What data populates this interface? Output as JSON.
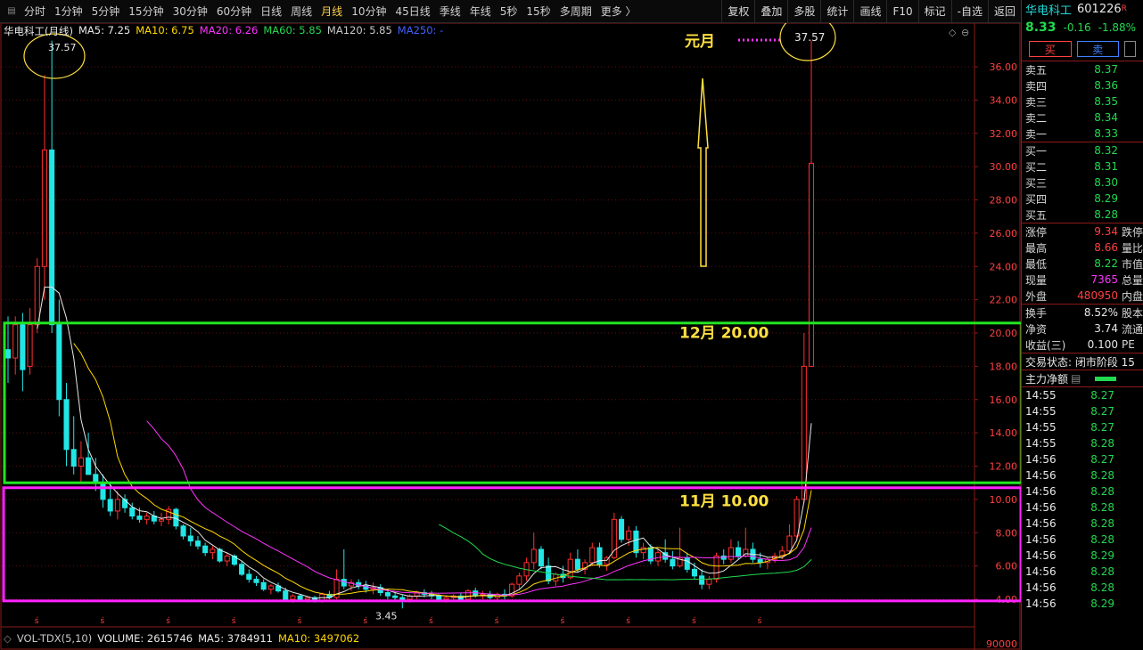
{
  "toolbar": {
    "periods": [
      "分时",
      "1分钟",
      "5分钟",
      "15分钟",
      "30分钟",
      "60分钟",
      "日线",
      "周线",
      "月线",
      "10分钟",
      "45日线",
      "季线",
      "年线",
      "5秒",
      "15秒",
      "多周期",
      "更多 〉"
    ],
    "active_period": "月线",
    "right_buttons": [
      "复权",
      "叠加",
      "多股",
      "统计",
      "画线",
      "F10",
      "标记",
      "-自选",
      "返回"
    ]
  },
  "chart_title": "华电科工(月线)",
  "ma_legend": [
    {
      "label": "MA5: 7.25",
      "color": "#e8e8e8"
    },
    {
      "label": "MA10: 6.75",
      "color": "#ffd800"
    },
    {
      "label": "MA20: 6.26",
      "color": "#ff33ff"
    },
    {
      "label": "MA60: 5.85",
      "color": "#22d94f"
    },
    {
      "label": "MA120: 5.85",
      "color": "#c8c8c8"
    },
    {
      "label": "MA250: -",
      "color": "#4060ff"
    }
  ],
  "vol_legend": [
    {
      "label": "VOL-TDX(5,10)",
      "color": "#c8c8c8"
    },
    {
      "label": "VOLUME: 2615746",
      "color": "#e8e8e8"
    },
    {
      "label": "MA5: 3784911",
      "color": "#e8e8e8"
    },
    {
      "label": "MA10: 3497062",
      "color": "#ffd800"
    }
  ],
  "annotations": {
    "high_left": "37.57",
    "high_right": "37.57",
    "low_label": "3.45",
    "yuanyue": "元月",
    "dec": "12月 20.00",
    "nov": "11月 10.00"
  },
  "axis": {
    "price_ticks": [
      "36.00",
      "34.00",
      "32.00",
      "30.00",
      "28.00",
      "26.00",
      "24.00",
      "22.00",
      "20.00",
      "18.00",
      "16.00",
      "14.00",
      "12.00",
      "10.00",
      "8.00",
      "6.00",
      "4.00"
    ],
    "vol_tick": "90000"
  },
  "chart_data": {
    "type": "candlestick",
    "title": "华电科工(月线)",
    "ylim": [
      3.45,
      37.57
    ],
    "monthly_ohlc": [
      [
        19,
        21,
        17,
        18.5
      ],
      [
        18.5,
        21,
        17.5,
        20.5
      ],
      [
        20.5,
        21.2,
        16.5,
        17.8
      ],
      [
        18,
        21.5,
        17.5,
        20.5
      ],
      [
        20.5,
        24.5,
        20,
        24
      ],
      [
        24,
        35.5,
        22,
        31
      ],
      [
        31,
        37.57,
        20,
        20.5
      ],
      [
        20.5,
        22,
        15,
        16
      ],
      [
        16,
        17,
        12,
        13
      ],
      [
        13,
        15,
        11.5,
        12
      ],
      [
        12,
        13.5,
        11,
        12.5
      ],
      [
        12.5,
        14,
        12,
        11.5
      ],
      [
        11.5,
        12.5,
        10.5,
        11
      ],
      [
        11,
        11.5,
        9.5,
        10
      ],
      [
        10,
        11,
        9,
        9.3
      ],
      [
        9.3,
        10.5,
        8.8,
        10
      ],
      [
        10,
        10.3,
        9.2,
        9.5
      ],
      [
        9.5,
        9.8,
        8.8,
        9
      ],
      [
        9,
        9.5,
        8.6,
        8.8
      ],
      [
        8.8,
        9.2,
        8.5,
        9
      ],
      [
        9,
        9.3,
        8.5,
        8.7
      ],
      [
        8.7,
        9.2,
        8.4,
        8.8
      ],
      [
        8.8,
        9.6,
        8.5,
        9.4
      ],
      [
        9.4,
        9.5,
        8.2,
        8.4
      ],
      [
        8.4,
        8.5,
        7.6,
        7.8
      ],
      [
        7.8,
        8.3,
        7.2,
        7.5
      ],
      [
        7.5,
        7.8,
        7,
        7.2
      ],
      [
        7.2,
        7.4,
        6.6,
        6.8
      ],
      [
        6.8,
        7.2,
        6.4,
        7
      ],
      [
        7,
        7.1,
        6.2,
        6.3
      ],
      [
        6.3,
        6.8,
        6,
        6.6
      ],
      [
        6.6,
        6.7,
        6,
        6.1
      ],
      [
        6.1,
        6.3,
        5.4,
        5.5
      ],
      [
        5.5,
        5.8,
        5,
        5.2
      ],
      [
        5.2,
        5.4,
        4.8,
        5
      ],
      [
        5,
        5.2,
        4.5,
        4.6
      ],
      [
        4.6,
        4.9,
        4.3,
        4.8
      ],
      [
        4.8,
        5,
        4.4,
        4.5
      ],
      [
        4.5,
        4.7,
        3.9,
        4
      ],
      [
        4,
        4.3,
        3.8,
        4.2
      ],
      [
        4.2,
        4.3,
        3.9,
        4
      ],
      [
        4,
        4.2,
        3.8,
        4.1
      ],
      [
        4.1,
        4.2,
        3.8,
        3.9
      ],
      [
        3.9,
        4.4,
        3.8,
        4.3
      ],
      [
        4.3,
        4.5,
        4,
        4.1
      ],
      [
        4.1,
        5.8,
        4,
        5.2
      ],
      [
        5.2,
        7,
        4.6,
        4.8
      ],
      [
        4.8,
        5.2,
        4.5,
        5
      ],
      [
        5,
        5.2,
        4.6,
        4.8
      ],
      [
        4.8,
        5.1,
        4.4,
        4.6
      ],
      [
        4.6,
        5,
        4.3,
        4.7
      ],
      [
        4.7,
        4.9,
        4.2,
        4.4
      ],
      [
        4.4,
        4.6,
        4,
        4.2
      ],
      [
        4.2,
        4.4,
        3.9,
        4.1
      ],
      [
        4.1,
        4.3,
        3.45,
        4
      ],
      [
        4,
        4.3,
        3.8,
        4.2
      ],
      [
        4.2,
        4.5,
        4,
        4.4
      ],
      [
        4.4,
        4.6,
        4.1,
        4.3
      ],
      [
        4.3,
        4.5,
        4,
        4.2
      ],
      [
        4.2,
        4.3,
        3.9,
        4
      ],
      [
        4,
        4.2,
        3.8,
        4.1
      ],
      [
        4.1,
        4.3,
        3.9,
        4.2
      ],
      [
        4.2,
        4.4,
        3.9,
        4
      ],
      [
        4,
        4.6,
        3.9,
        4.5
      ],
      [
        4.5,
        4.7,
        4.1,
        4.2
      ],
      [
        4.2,
        4.5,
        4,
        4.3
      ],
      [
        4.3,
        4.5,
        4,
        4.1
      ],
      [
        4.1,
        4.4,
        3.9,
        4.3
      ],
      [
        4.3,
        4.6,
        4,
        4.2
      ],
      [
        4.2,
        5,
        4.1,
        4.9
      ],
      [
        4.9,
        5.6,
        4.6,
        5.4
      ],
      [
        5.4,
        6.5,
        5.1,
        6.2
      ],
      [
        6.2,
        8,
        5.8,
        7
      ],
      [
        7,
        7.2,
        5.8,
        6
      ],
      [
        6,
        6.5,
        4.9,
        5.1
      ],
      [
        5.1,
        5.6,
        4.8,
        5.5
      ],
      [
        5.5,
        6,
        5,
        5.3
      ],
      [
        5.3,
        6.8,
        5.2,
        6.4
      ],
      [
        6.4,
        7,
        5.6,
        5.8
      ],
      [
        5.8,
        6.4,
        5.5,
        6.2
      ],
      [
        6.2,
        7.4,
        6,
        7.1
      ],
      [
        7.1,
        7.4,
        5.9,
        6.1
      ],
      [
        6.1,
        6.6,
        5.7,
        6.5
      ],
      [
        6.5,
        9.2,
        6.4,
        8.8
      ],
      [
        8.8,
        9,
        7.4,
        7.6
      ],
      [
        7.6,
        8.4,
        7.2,
        8.1
      ],
      [
        8.1,
        8.4,
        6.5,
        6.8
      ],
      [
        6.8,
        7.4,
        6.4,
        7.1
      ],
      [
        7.1,
        7.3,
        6.1,
        6.3
      ],
      [
        6.3,
        7,
        6,
        6.8
      ],
      [
        6.8,
        7.6,
        6.2,
        6.4
      ],
      [
        6.4,
        6.9,
        5.8,
        6
      ],
      [
        6,
        8.3,
        5.9,
        6.5
      ],
      [
        6.5,
        6.8,
        5.6,
        5.8
      ],
      [
        5.8,
        6.2,
        5.2,
        5.4
      ],
      [
        5.4,
        5.8,
        4.6,
        4.9
      ],
      [
        4.9,
        5.4,
        4.6,
        5.2
      ],
      [
        5.2,
        6.8,
        5,
        6.6
      ],
      [
        6.6,
        7,
        6.1,
        6.4
      ],
      [
        6.4,
        7.6,
        6.2,
        7.1
      ],
      [
        7.1,
        7.5,
        6.4,
        6.6
      ],
      [
        6.6,
        8.3,
        6.5,
        7
      ],
      [
        7,
        7.4,
        6.2,
        6.4
      ],
      [
        6.4,
        6.8,
        5.9,
        6.2
      ],
      [
        6.2,
        6.5,
        5.8,
        6.4
      ],
      [
        6.4,
        6.8,
        6.2,
        6.6
      ],
      [
        6.6,
        7.2,
        6.4,
        6.9
      ],
      [
        6.9,
        8.5,
        6.7,
        7.8
      ],
      [
        7.8,
        10.2,
        7.6,
        10
      ],
      [
        10,
        20,
        9.8,
        18
      ],
      [
        18,
        37.57,
        18,
        30.2
      ]
    ],
    "notes": {
      "high": 37.57,
      "low": 3.45
    }
  },
  "panel": {
    "stock_name": "华电科工",
    "stock_code": "601226",
    "badge": "R",
    "price": "8.33",
    "change": "-0.16",
    "change_pct": "-1.88%",
    "buy_label": "买",
    "sell_label": "卖",
    "asks": [
      {
        "label": "卖五",
        "price": "8.37"
      },
      {
        "label": "卖四",
        "price": "8.36"
      },
      {
        "label": "卖三",
        "price": "8.35"
      },
      {
        "label": "卖二",
        "price": "8.34"
      },
      {
        "label": "卖一",
        "price": "8.33"
      }
    ],
    "bids": [
      {
        "label": "买一",
        "price": "8.32"
      },
      {
        "label": "买二",
        "price": "8.31"
      },
      {
        "label": "买三",
        "price": "8.30"
      },
      {
        "label": "买四",
        "price": "8.29"
      },
      {
        "label": "买五",
        "price": "8.28"
      }
    ],
    "stats": [
      {
        "label": "涨停",
        "val": "9.34",
        "cls": "r",
        "ex": "跌停"
      },
      {
        "label": "最高",
        "val": "8.66",
        "cls": "r",
        "ex": "量比"
      },
      {
        "label": "最低",
        "val": "8.22",
        "cls": "g",
        "ex": "市值"
      },
      {
        "label": "现量",
        "val": "7365",
        "cls": "m",
        "ex": "总量"
      },
      {
        "label": "外盘",
        "val": "480950",
        "cls": "r",
        "ex": "内盘"
      }
    ],
    "stats2": [
      {
        "label": "换手",
        "val": "8.52%",
        "cls": "w",
        "ex": "股本"
      },
      {
        "label": "净资",
        "val": "3.74",
        "cls": "w",
        "ex": "流通"
      },
      {
        "label": "收益(三)",
        "val": "0.100",
        "cls": "w",
        "ex": "PE"
      }
    ],
    "trade_status": "交易状态: 闭市阶段 15",
    "main_net_label": "主力净额",
    "ticks": [
      {
        "t": "14:55",
        "p": "8.27"
      },
      {
        "t": "14:55",
        "p": "8.27"
      },
      {
        "t": "14:55",
        "p": "8.27"
      },
      {
        "t": "14:55",
        "p": "8.28"
      },
      {
        "t": "14:56",
        "p": "8.27"
      },
      {
        "t": "14:56",
        "p": "8.28"
      },
      {
        "t": "14:56",
        "p": "8.28"
      },
      {
        "t": "14:56",
        "p": "8.28"
      },
      {
        "t": "14:56",
        "p": "8.28"
      },
      {
        "t": "14:56",
        "p": "8.28"
      },
      {
        "t": "14:56",
        "p": "8.29"
      },
      {
        "t": "14:56",
        "p": "8.28"
      },
      {
        "t": "14:56",
        "p": "8.28"
      },
      {
        "t": "14:56",
        "p": "8.29"
      }
    ]
  }
}
